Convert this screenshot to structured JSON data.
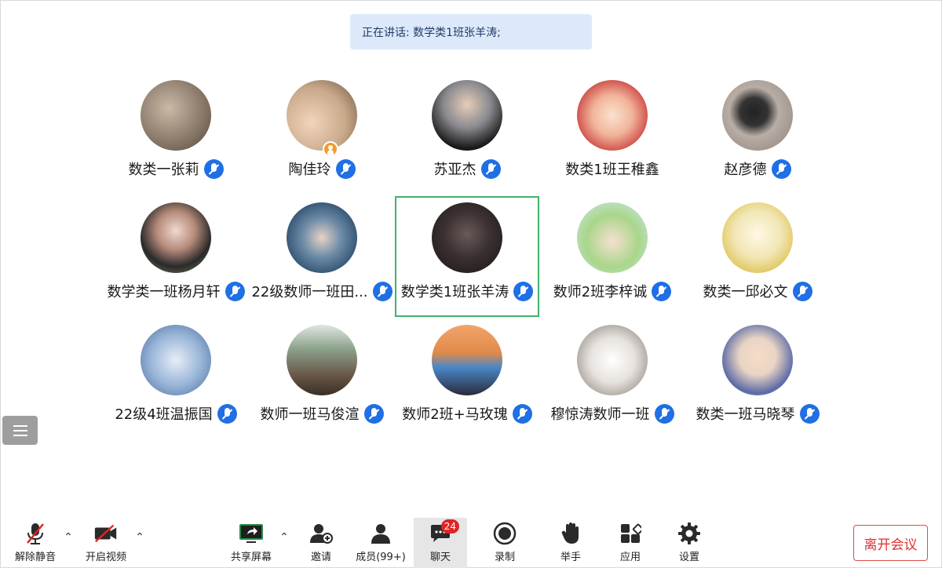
{
  "banner": {
    "text": "正在讲话: 数学类1班张羊涛;"
  },
  "participants": [
    {
      "name": "数类一张莉",
      "avatar_color": "#8a7a6a",
      "host": false,
      "active": false
    },
    {
      "name": "陶佳玲",
      "avatar_color": "#c9a98a",
      "host": true,
      "active": false
    },
    {
      "name": "苏亚杰",
      "avatar_color": "#2a2a2a",
      "host": false,
      "active": false
    },
    {
      "name": "数类1班王稚鑫",
      "avatar_color": "#e86a6a",
      "host": false,
      "active": false
    },
    {
      "name": "赵彦德",
      "avatar_color": "#8a8079",
      "host": false,
      "active": false
    },
    {
      "name": "数学类一班杨月轩",
      "avatar_color": "#9a6a5a",
      "host": false,
      "active": false
    },
    {
      "name": "22级数师一班田...",
      "avatar_color": "#3a6a8a",
      "host": false,
      "active": false
    },
    {
      "name": "数学类1班张羊涛",
      "avatar_color": "#3a3030",
      "host": false,
      "active": true
    },
    {
      "name": "数师2班李梓诚",
      "avatar_color": "#a9d68a",
      "host": false,
      "active": false
    },
    {
      "name": "数类一邱必文",
      "avatar_color": "#f1e6b4",
      "host": false,
      "active": false
    },
    {
      "name": "22级4班温振国",
      "avatar_color": "#7a9cc9",
      "host": false,
      "active": false
    },
    {
      "name": "数师一班马俊渲",
      "avatar_color": "#6a7a6a",
      "host": false,
      "active": false
    },
    {
      "name": "数师2班+马玫瑰",
      "avatar_color": "#e08a4a",
      "host": false,
      "active": false
    },
    {
      "name": "穆惊涛数师一班",
      "avatar_color": "#d9d4cf",
      "host": false,
      "active": false
    },
    {
      "name": "数类一班马晓琴",
      "avatar_color": "#e9d4c4",
      "host": false,
      "active": false
    }
  ],
  "toolbar": {
    "unmute_label": "解除静音",
    "video_label": "开启视频",
    "share_label": "共享屏幕",
    "invite_label": "邀请",
    "members_label": "成员(99+)",
    "chat_label": "聊天",
    "chat_unread": "24",
    "record_label": "录制",
    "raise_hand_label": "举手",
    "apps_label": "应用",
    "settings_label": "设置",
    "leave_label": "离开会议"
  },
  "colors": {
    "accent_blue": "#1f6fe5",
    "active_border": "#3fb26c",
    "leave_red": "#e0302f",
    "banner_bg": "#dde9fb"
  }
}
